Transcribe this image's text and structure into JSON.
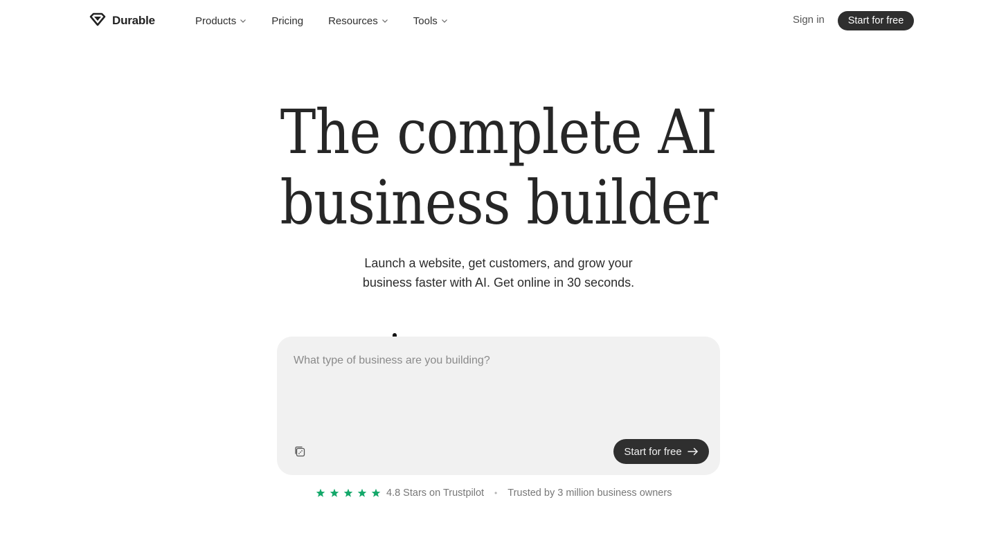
{
  "brand": {
    "name": "Durable",
    "logo_icon": "diamond-logo-icon"
  },
  "nav": {
    "items": [
      {
        "label": "Products",
        "dropdown": true
      },
      {
        "label": "Pricing",
        "dropdown": false
      },
      {
        "label": "Resources",
        "dropdown": true
      },
      {
        "label": "Tools",
        "dropdown": true
      }
    ]
  },
  "header": {
    "sign_in": "Sign in",
    "cta": "Start for free"
  },
  "hero": {
    "title_line1": "The complete AI",
    "title_line2": "business builder",
    "subtitle_line1": "Launch a website, get customers, and grow your",
    "subtitle_line2": "business faster with AI. Get online in 30 seconds."
  },
  "prompt": {
    "placeholder": "What type of business are you building?",
    "value": "",
    "randomize_icon": "dice-icon",
    "cta": "Start for free",
    "cta_icon": "arrow-right-icon"
  },
  "trust": {
    "stars": 5,
    "rating_text": "4.8 Stars on Trustpilot",
    "separator": "•",
    "trusted_text": "Trusted by 3 million business owners",
    "star_color": "#14a86a"
  },
  "colors": {
    "button_dark": "#2f2f2f",
    "input_bg": "#f1f1f1",
    "text": "#262626"
  }
}
